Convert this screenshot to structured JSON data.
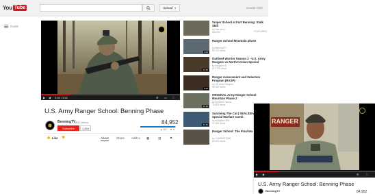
{
  "masthead": {
    "logo_you": "You",
    "logo_tube": "Tube",
    "search_placeholder": "",
    "upload_label": "Upload",
    "signin_label": "Create Alert"
  },
  "guide": {
    "label": "Guide"
  },
  "player": {
    "time": "0:48 / 3:52",
    "progress_fraction": 0.21
  },
  "video": {
    "title": "U.S. Army Ranger School: Benning Phase",
    "channel": "BenningTV",
    "channel_videos": "863 videos",
    "subscribe_label": "Subscribe",
    "subscriber_count": "1,854",
    "views": "84,952",
    "likes": "467",
    "dislikes": "6",
    "like_ratio": 0.98,
    "like_label": "Like",
    "tabs": [
      "About",
      "Share",
      "Add to"
    ]
  },
  "related": [
    {
      "title": "Sniper School at Fort Benning: Stalk Skill",
      "channel": "by Usa Army",
      "views": "800,000",
      "duration": "",
      "badge": "FEATURED",
      "thumb_color": "#6e6a5a"
    },
    {
      "title": "Ranger School Mountain phase",
      "channel": "by BenningTV",
      "views": "95,747 views",
      "duration": "3:02",
      "badge": "",
      "thumb_color": "#5b6a73"
    },
    {
      "title": "Outlived Warrior Season 3 - U.S. Army Rangers vs North Korean Special",
      "channel": "by benjamin B",
      "views": "212,709 views",
      "duration": "44:35",
      "badge": "",
      "thumb_color": "#4a3a2a"
    },
    {
      "title": "Ranger Assessment and Selection Program (RASP)",
      "channel": "by US Army Rangers",
      "views": "95,940 views",
      "duration": "5:20",
      "badge": "",
      "thumb_color": "#3c2e22"
    },
    {
      "title": "ORIGINAL Army Ranger School Mountain Phase 2",
      "channel": "by ayadoum sanna",
      "views": "75,905 views",
      "duration": "10:30",
      "badge": "",
      "thumb_color": "#6a6f60"
    },
    {
      "title": "Surviving The Cut | SEAL/DEV Naval Special Warfare Comb",
      "channel": "by mangtoon RW",
      "views": "97,905 views",
      "duration": "42:40",
      "badge": "",
      "thumb_color": "#3e5a74"
    },
    {
      "title": "Ranger School: The Final Ma",
      "channel": "by CLIMBER 5380",
      "views": "59,910 views",
      "duration": "",
      "badge": "",
      "thumb_color": "#5a5147"
    }
  ],
  "popup": {
    "sign_text": "RANGER",
    "caption_text": "",
    "title": "U.S. Army Ranger School: Benning Phase",
    "channel": "BenningTV",
    "views": "84,952",
    "progress_fraction": 0.21
  },
  "colors": {
    "brand_red": "#cc181e",
    "subscribe_red": "#e62117",
    "like_blue": "#167ac6"
  },
  "icons": {
    "search": "search-icon",
    "guide": "guide-menu-icon",
    "play": "play-icon",
    "volume": "volume-icon",
    "fullscreen": "fullscreen-icon",
    "settings": "settings-gear-icon",
    "like": "thumbs-up-icon"
  }
}
